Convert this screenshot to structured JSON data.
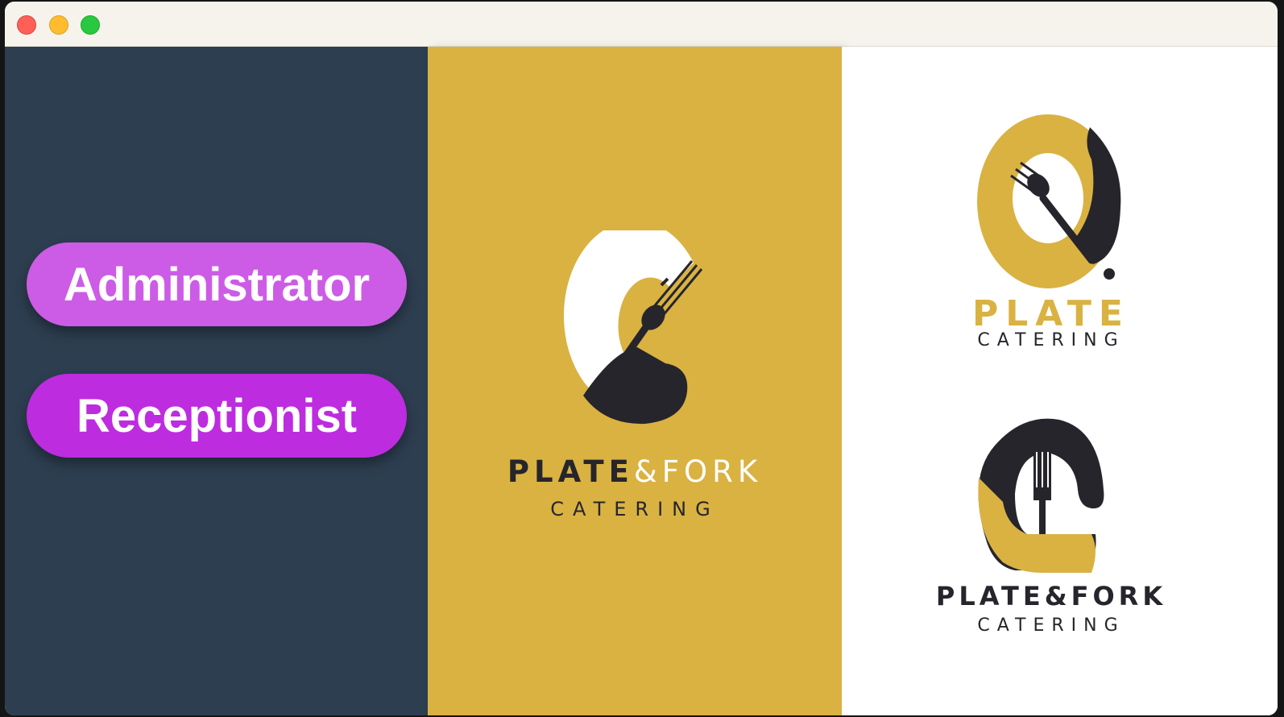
{
  "roles": {
    "admin_label": "Administrator",
    "receptionist_label": "Receptionist"
  },
  "logo_center": {
    "name_bold": "PLATE",
    "name_light": "&FORK",
    "subtitle": "CATERING"
  },
  "logo_top_right": {
    "name": "PLATE",
    "subtitle": "CATERING"
  },
  "logo_bottom_right": {
    "name": "PLATE&FORK",
    "subtitle": "CATERING"
  },
  "colors": {
    "sidebar_bg": "#2d3e50",
    "gold": "#d9b242",
    "dark": "#26252c",
    "admin_button": "#cc5ce6",
    "receptionist_button": "#bd2cdf"
  },
  "icons": [
    "window-close-icon",
    "window-minimize-icon",
    "window-maximize-icon",
    "fork-icon"
  ]
}
